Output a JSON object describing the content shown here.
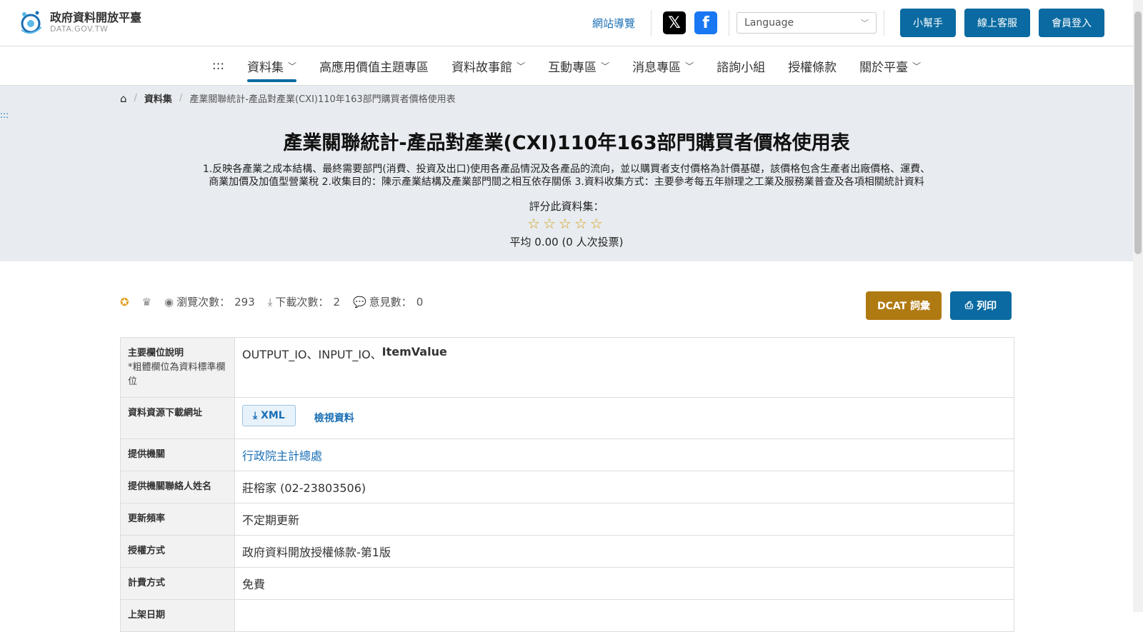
{
  "header": {
    "logo_title": "政府資料開放平臺",
    "logo_sub": "DATA.GOV.TW",
    "sitemap": "網站導覽",
    "language_placeholder": "Language",
    "buttons": [
      "小幫手",
      "線上客服",
      "會員登入"
    ]
  },
  "nav": {
    "items": [
      {
        "label": ":::",
        "has_dropdown": false
      },
      {
        "label": "資料集",
        "has_dropdown": true
      },
      {
        "label": "高應用價值主題專區",
        "has_dropdown": false
      },
      {
        "label": "資料故事館",
        "has_dropdown": true
      },
      {
        "label": "互動專區",
        "has_dropdown": true
      },
      {
        "label": "消息專區",
        "has_dropdown": true
      },
      {
        "label": "諮詢小組",
        "has_dropdown": false
      },
      {
        "label": "授權條款",
        "has_dropdown": false
      },
      {
        "label": "關於平臺",
        "has_dropdown": true
      }
    ]
  },
  "breadcrumb": {
    "section": "資料集",
    "current": "產業關聯統計-產品對產業(CXI)110年163部門購買者價格使用表"
  },
  "side_marker": ":::",
  "dataset": {
    "title": "產業關聯統計-產品對產業(CXI)110年163部門購買者價格使用表",
    "description_line1": "1.反映各產業之成本結構、最終需要部門(消費、投資及出口)使用各產品情況及各產品的流向，並以購買者支付價格為計價基礎，該價格包含生產者出廠價格、運費、",
    "description_line2": "商業加價及加值型營業稅 2.收集目的：陳示產業結構及產業部門間之相互依存關係 3.資料收集方式：主要參考每五年辦理之工業及服務業普查及各項相關統計資料",
    "rate_label": "評分此資料集：",
    "stars": "☆☆☆☆☆",
    "average": "平均 0.00 (0 人次投票)"
  },
  "stats": {
    "views_label": "瀏覽次數：",
    "views": "293",
    "downloads_label": "下載次數：",
    "downloads": "2",
    "comments_label": "意見數：",
    "comments": "0",
    "dcat_button": "DCAT 詞彙",
    "print_button": "列印"
  },
  "table": {
    "fields_header": "主要欄位說明",
    "fields_note": "*粗體欄位為資料標準欄位",
    "fields_plain": "OUTPUT_IO、INPUT_IO、",
    "fields_bold": "ItemValue",
    "download_header": "資料資源下載網址",
    "xml_button": "XML",
    "view_link": "檢視資料",
    "provider_header": "提供機關",
    "provider": "行政院主計總處",
    "contact_header": "提供機關聯絡人姓名",
    "contact": "莊榕家 (02-23803506)",
    "freq_header": "更新頻率",
    "freq": "不定期更新",
    "license_header": "授權方式",
    "license": "政府資料開放授權條款-第1版",
    "fee_header": "計費方式",
    "fee": "免費",
    "partial_header": "上架日期"
  },
  "colors": {
    "brand_blue": "#0a6aa1",
    "dcat_gold": "#b07a12",
    "hero_bg": "#e8ecf0",
    "star": "#d4a017"
  }
}
